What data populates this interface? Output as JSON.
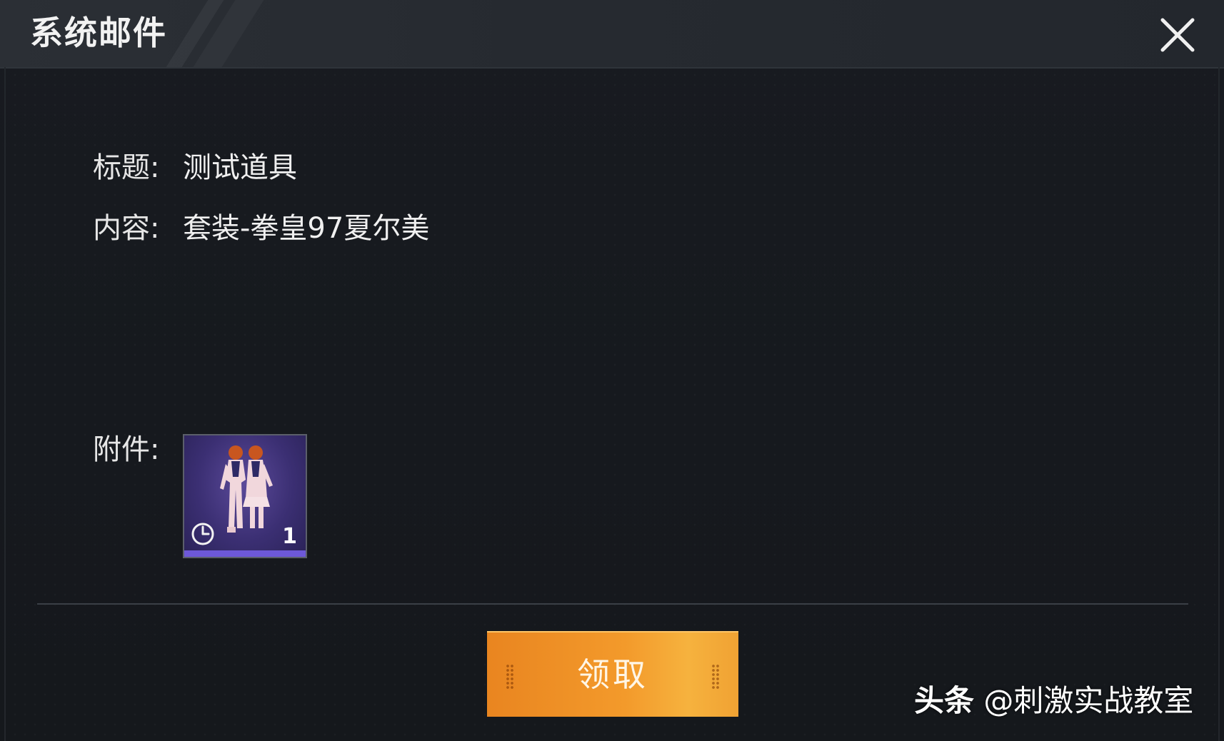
{
  "window": {
    "title": "系统邮件"
  },
  "mail": {
    "subject_label": "标题:",
    "subject_value": "测试道具",
    "content_label": "内容:",
    "content_value": "套装-拳皇97夏尔美",
    "attachment_label": "附件:"
  },
  "attachment": {
    "icon": "outfit-icon",
    "badge_icon": "clock-icon",
    "count": "1",
    "rarity_color": "#6d58d8"
  },
  "actions": {
    "claim_label": "领取"
  },
  "watermark": {
    "brand": "头条",
    "handle": "@刺激实战教室"
  },
  "colors": {
    "accent": "#f39a2b",
    "background": "#16191e"
  }
}
